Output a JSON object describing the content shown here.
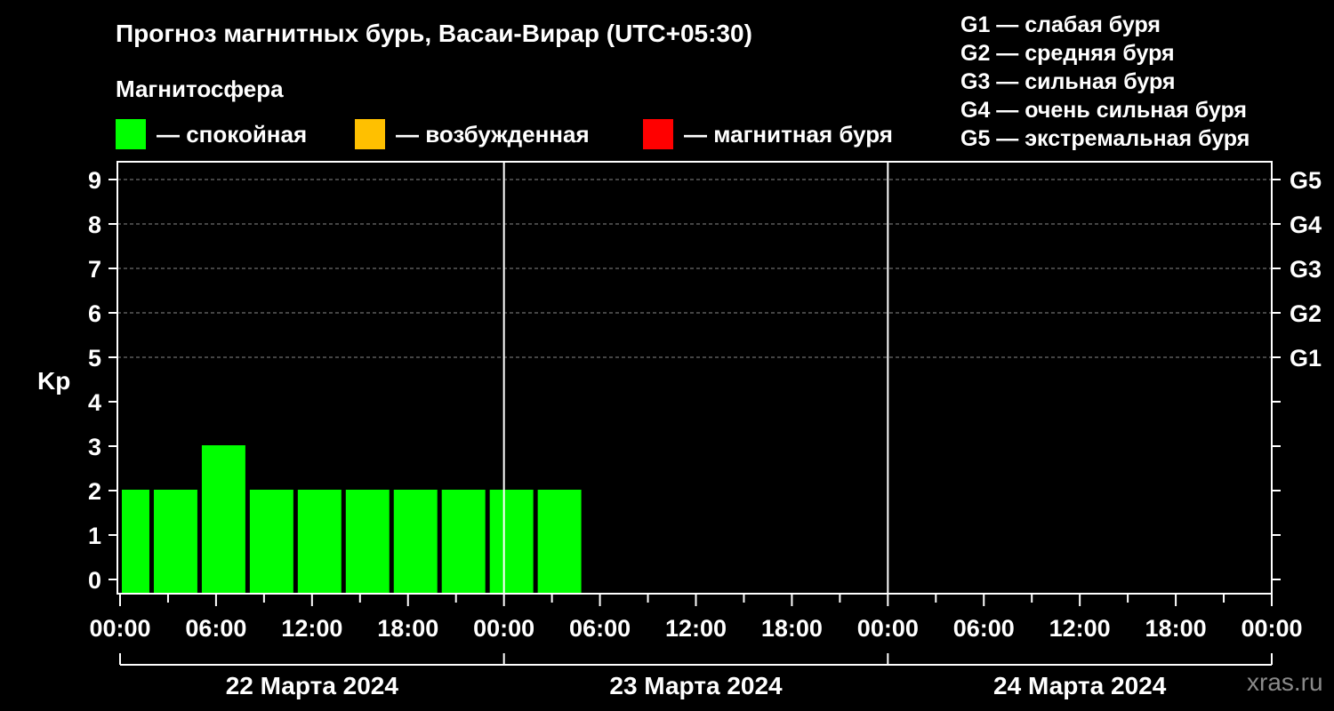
{
  "title": "Прогноз магнитных бурь, Васаи-Вирар (UTC+05:30)",
  "legend": {
    "title": "Магнитосфера",
    "items": [
      {
        "label": "— спокойная",
        "color": "#00ff00"
      },
      {
        "label": "— возбужденная",
        "color": "#ffc000"
      },
      {
        "label": "— магнитная буря",
        "color": "#ff0000"
      }
    ]
  },
  "g_scale": [
    "G1 — слабая буря",
    "G2 — средняя буря",
    "G3 — сильная буря",
    "G4 — очень сильная буря",
    "G5 — экстремальная буря"
  ],
  "watermark": "xras.ru",
  "chart_data": {
    "type": "bar",
    "ylabel": "Kp",
    "ylim": [
      0,
      9
    ],
    "y_ticks": [
      0,
      1,
      2,
      3,
      4,
      5,
      6,
      7,
      8,
      9
    ],
    "right_ticks": [
      {
        "value": 5,
        "label": "G1"
      },
      {
        "value": 6,
        "label": "G2"
      },
      {
        "value": 7,
        "label": "G3"
      },
      {
        "value": 8,
        "label": "G4"
      },
      {
        "value": 9,
        "label": "G5"
      }
    ],
    "x_range_hours": [
      0,
      72
    ],
    "x_tick_labels": [
      {
        "hour": 0,
        "label": "00:00"
      },
      {
        "hour": 6,
        "label": "06:00"
      },
      {
        "hour": 12,
        "label": "12:00"
      },
      {
        "hour": 18,
        "label": "18:00"
      },
      {
        "hour": 24,
        "label": "00:00"
      },
      {
        "hour": 30,
        "label": "06:00"
      },
      {
        "hour": 36,
        "label": "12:00"
      },
      {
        "hour": 42,
        "label": "18:00"
      },
      {
        "hour": 48,
        "label": "00:00"
      },
      {
        "hour": 54,
        "label": "06:00"
      },
      {
        "hour": 60,
        "label": "12:00"
      },
      {
        "hour": 66,
        "label": "18:00"
      },
      {
        "hour": 72,
        "label": "00:00"
      }
    ],
    "days": [
      "22 Марта 2024",
      "23 Марта 2024",
      "24 Марта 2024"
    ],
    "grid": true,
    "bars": [
      {
        "start_hour": 0,
        "end_hour": 2,
        "value": 2,
        "color": "#00ff00"
      },
      {
        "start_hour": 2,
        "end_hour": 5,
        "value": 2,
        "color": "#00ff00"
      },
      {
        "start_hour": 5,
        "end_hour": 8,
        "value": 3,
        "color": "#00ff00"
      },
      {
        "start_hour": 8,
        "end_hour": 11,
        "value": 2,
        "color": "#00ff00"
      },
      {
        "start_hour": 11,
        "end_hour": 14,
        "value": 2,
        "color": "#00ff00"
      },
      {
        "start_hour": 14,
        "end_hour": 17,
        "value": 2,
        "color": "#00ff00"
      },
      {
        "start_hour": 17,
        "end_hour": 20,
        "value": 2,
        "color": "#00ff00"
      },
      {
        "start_hour": 20,
        "end_hour": 23,
        "value": 2,
        "color": "#00ff00"
      },
      {
        "start_hour": 23,
        "end_hour": 26,
        "value": 2,
        "color": "#00ff00"
      },
      {
        "start_hour": 26,
        "end_hour": 29,
        "value": 2,
        "color": "#00ff00"
      }
    ]
  }
}
